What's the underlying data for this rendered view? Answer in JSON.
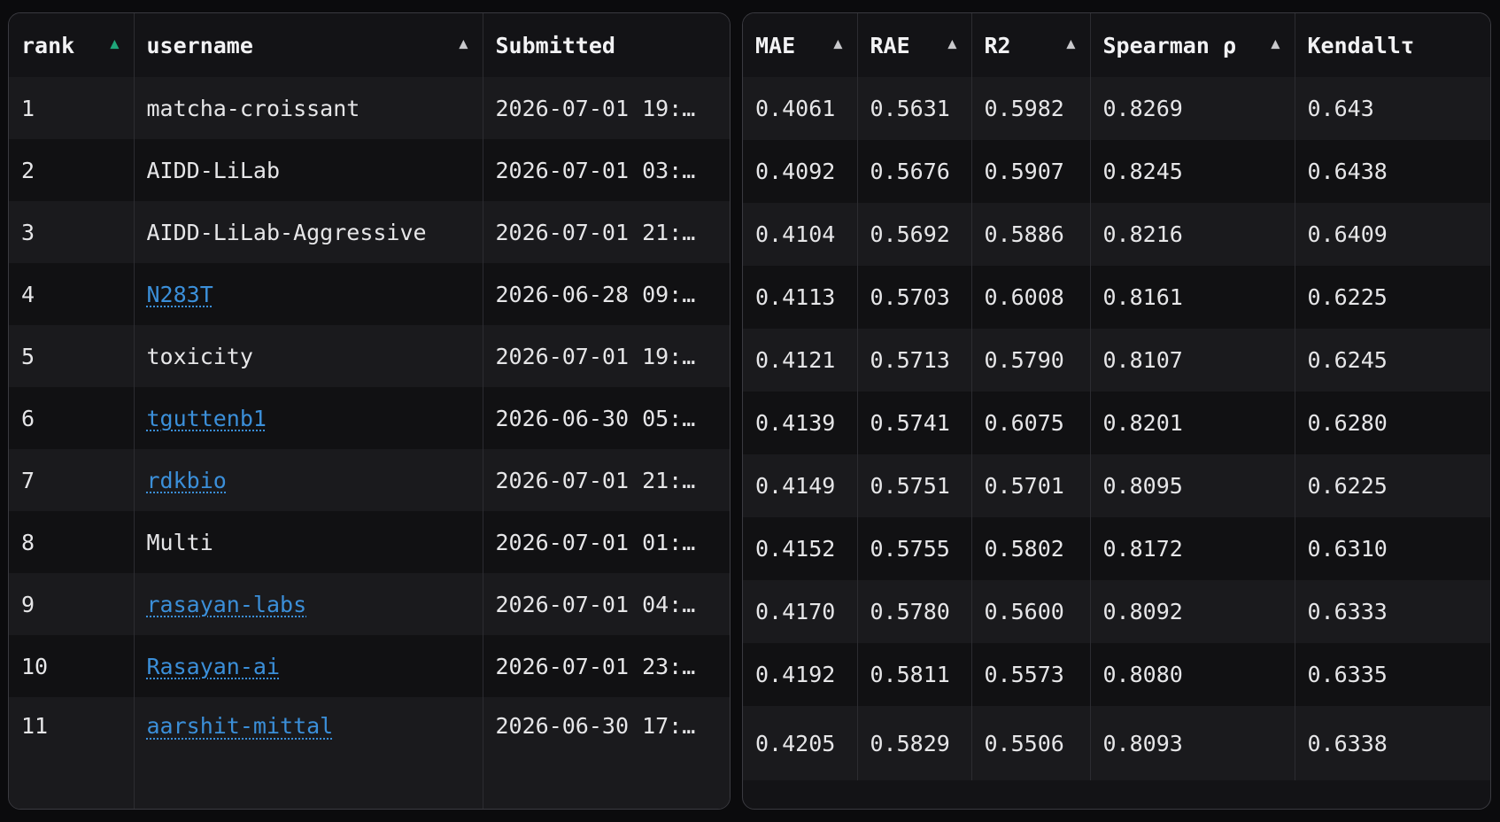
{
  "left_table": {
    "headers": [
      {
        "label": "rank",
        "arrow": "▲",
        "active": true
      },
      {
        "label": "username",
        "arrow": "▲",
        "active": false
      },
      {
        "label": "Submitted",
        "arrow": "",
        "active": false
      }
    ]
  },
  "right_table": {
    "headers": [
      {
        "label": "MAE",
        "arrow": "▲"
      },
      {
        "label": "RAE",
        "arrow": "▲"
      },
      {
        "label": "R2",
        "arrow": "▲"
      },
      {
        "label": "Spearman ρ",
        "arrow": "▲"
      },
      {
        "label": "Kendallτ",
        "arrow": ""
      }
    ]
  },
  "rows": [
    {
      "rank": "1",
      "username": "matcha-croissant",
      "is_link": false,
      "submitted": "2026-07-01 19:…",
      "mae": "0.4061",
      "rae": "0.5631",
      "r2": "0.5982",
      "spearman": "0.8269",
      "kendall": "0.643"
    },
    {
      "rank": "2",
      "username": "AIDD-LiLab",
      "is_link": false,
      "submitted": "2026-07-01 03:…",
      "mae": "0.4092",
      "rae": "0.5676",
      "r2": "0.5907",
      "spearman": "0.8245",
      "kendall": "0.6438"
    },
    {
      "rank": "3",
      "username": "AIDD-LiLab-Aggressive",
      "is_link": false,
      "submitted": "2026-07-01 21:…",
      "mae": "0.4104",
      "rae": "0.5692",
      "r2": "0.5886",
      "spearman": "0.8216",
      "kendall": "0.6409"
    },
    {
      "rank": "4",
      "username": "N283T",
      "is_link": true,
      "submitted": "2026-06-28 09:…",
      "mae": "0.4113",
      "rae": "0.5703",
      "r2": "0.6008",
      "spearman": "0.8161",
      "kendall": "0.6225"
    },
    {
      "rank": "5",
      "username": "toxicity",
      "is_link": false,
      "submitted": "2026-07-01 19:…",
      "mae": "0.4121",
      "rae": "0.5713",
      "r2": "0.5790",
      "spearman": "0.8107",
      "kendall": "0.6245"
    },
    {
      "rank": "6",
      "username": "tguttenb1",
      "is_link": true,
      "submitted": "2026-06-30 05:…",
      "mae": "0.4139",
      "rae": "0.5741",
      "r2": "0.6075",
      "spearman": "0.8201",
      "kendall": "0.6280"
    },
    {
      "rank": "7",
      "username": "rdkbio",
      "is_link": true,
      "submitted": "2026-07-01 21:…",
      "mae": "0.4149",
      "rae": "0.5751",
      "r2": "0.5701",
      "spearman": "0.8095",
      "kendall": "0.6225"
    },
    {
      "rank": "8",
      "username": "Multi",
      "is_link": false,
      "submitted": "2026-07-01 01:…",
      "mae": "0.4152",
      "rae": "0.5755",
      "r2": "0.5802",
      "spearman": "0.8172",
      "kendall": "0.6310"
    },
    {
      "rank": "9",
      "username": "rasayan-labs",
      "is_link": true,
      "submitted": "2026-07-01 04:…",
      "mae": "0.4170",
      "rae": "0.5780",
      "r2": "0.5600",
      "spearman": "0.8092",
      "kendall": "0.6333"
    },
    {
      "rank": "10",
      "username": "Rasayan-ai",
      "is_link": true,
      "submitted": "2026-07-01 23:…",
      "mae": "0.4192",
      "rae": "0.5811",
      "r2": "0.5573",
      "spearman": "0.8080",
      "kendall": "0.6335"
    },
    {
      "rank": "11",
      "username": "aarshit-mittal",
      "is_link": true,
      "submitted": "2026-06-30 17:…",
      "mae": "0.4205",
      "rae": "0.5829",
      "r2": "0.5506",
      "spearman": "0.8093",
      "kendall": "0.6338"
    }
  ],
  "colors": {
    "background": "#0b0b0d",
    "panel": "#131316",
    "row_odd": "#1a1a1d",
    "row_even": "#111113",
    "link": "#3b8fd9",
    "active_sort": "#1fa67a"
  }
}
